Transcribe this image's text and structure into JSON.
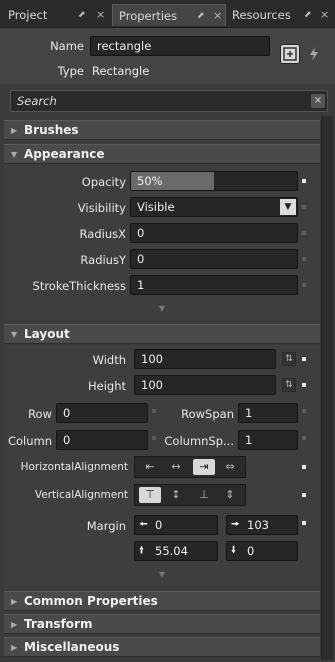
{
  "tabs": [
    {
      "label": "Project",
      "pin": "⬈",
      "close": "×"
    },
    {
      "label": "Properties",
      "pin": "⬈",
      "close": "×"
    },
    {
      "label": "Resources",
      "pin": "⬈",
      "close": "×"
    }
  ],
  "header": {
    "name_label": "Name",
    "name_value": "rectangle",
    "type_label": "Type",
    "type_value": "Rectangle"
  },
  "search": {
    "placeholder": "Search",
    "clear": "×"
  },
  "categories": {
    "brushes": "Brushes",
    "appearance": "Appearance",
    "layout": "Layout",
    "common": "Common Properties",
    "transform": "Transform",
    "misc": "Miscellaneous"
  },
  "appearance": {
    "opacity_label": "Opacity",
    "opacity_value": "50%",
    "opacity_level": 0.5,
    "visibility_label": "Visibility",
    "visibility_value": "Visible",
    "radiusx_label": "RadiusX",
    "radiusx_value": "0",
    "radiusy_label": "RadiusY",
    "radiusy_value": "0",
    "stroke_label": "StrokeThickness",
    "stroke_value": "1"
  },
  "layout": {
    "width_label": "Width",
    "width_value": "100",
    "height_label": "Height",
    "height_value": "100",
    "row_label": "Row",
    "row_value": "0",
    "rowspan_label": "RowSpan",
    "rowspan_value": "1",
    "column_label": "Column",
    "column_value": "0",
    "columnspan_label": "ColumnSp...",
    "columnspan_value": "1",
    "halign_label": "HorizontalAlignment",
    "halign_selected": "right",
    "valign_label": "VerticalAlignment",
    "valign_selected": "top",
    "margin_label": "Margin",
    "margin_left": "0",
    "margin_right": "103",
    "margin_top": "55.04",
    "margin_bottom": "0"
  }
}
